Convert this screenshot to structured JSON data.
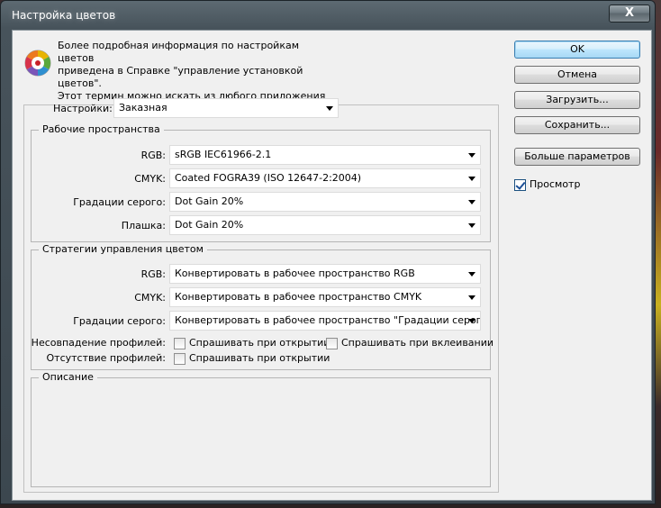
{
  "window": {
    "title": "Настройка цветов",
    "close_glyph": "X"
  },
  "info": {
    "icon": "color-wheel-icon",
    "text": "Более подробная информация по настройкам цветов\nприведена в Справке \"управление установкой цветов\".\nЭтот термин можно искать из любого приложения\nCreative Suite."
  },
  "buttons": {
    "ok": "OK",
    "cancel": "Отмена",
    "load": "Загрузить...",
    "save": "Сохранить...",
    "more": "Больше параметров"
  },
  "preview": {
    "label": "Просмотр",
    "checked": true
  },
  "settings": {
    "label": "Настройки:",
    "value": "Заказная"
  },
  "working_spaces": {
    "title": "Рабочие пространства",
    "rgb_label": "RGB:",
    "rgb_value": "sRGB IEC61966-2.1",
    "cmyk_label": "CMYK:",
    "cmyk_value": "Coated FOGRA39 (ISO 12647-2:2004)",
    "gray_label": "Градации серого:",
    "gray_value": "Dot Gain 20%",
    "spot_label": "Плашка:",
    "spot_value": "Dot Gain 20%"
  },
  "policies": {
    "title": "Стратегии управления цветом",
    "rgb_label": "RGB:",
    "rgb_value": "Конвертировать в рабочее пространство RGB",
    "cmyk_label": "CMYK:",
    "cmyk_value": "Конвертировать в рабочее пространство CMYK",
    "gray_label": "Градации серого:",
    "gray_value": "Конвертировать в рабочее пространство \"Градации серого\"",
    "mismatch_label": "Несовпадение профилей:",
    "mismatch_open": "Спрашивать при открытии",
    "mismatch_paste": "Спрашивать при вклеивании",
    "missing_label": "Отсутствие профилей:",
    "missing_open": "Спрашивать при открытии"
  },
  "description": {
    "title": "Описание"
  }
}
